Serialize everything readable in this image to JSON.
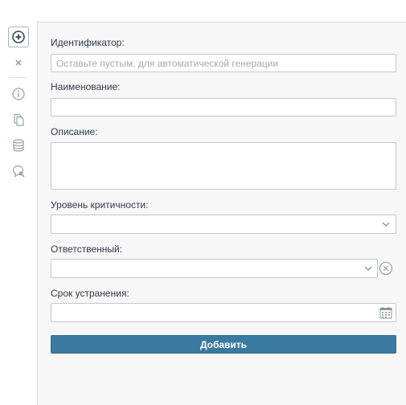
{
  "toolbar": {
    "buttons": [
      {
        "icon": "add-circle-icon",
        "active": true
      },
      {
        "icon": "close-icon",
        "active": false
      },
      {
        "icon": "info-icon",
        "active": false
      },
      {
        "icon": "copy-icon",
        "active": false
      },
      {
        "icon": "database-icon",
        "active": false
      },
      {
        "icon": "comment-search-icon",
        "active": false
      }
    ]
  },
  "form": {
    "id_label": "Идентификатор:",
    "id_placeholder": "Оставьте пустым, для автоматической генерации",
    "id_value": "",
    "name_label": "Наименование:",
    "name_value": "",
    "description_label": "Описание:",
    "description_value": "",
    "severity_label": "Уровень критичности:",
    "severity_selected": "",
    "responsible_label": "Ответственный:",
    "responsible_selected": "",
    "deadline_label": "Срок устранения:",
    "deadline_value": "",
    "submit_label": "Добавить"
  },
  "colors": {
    "accent": "#3a7aa0",
    "panel_bg": "#f7f7f7",
    "border": "#c3c7cc"
  }
}
